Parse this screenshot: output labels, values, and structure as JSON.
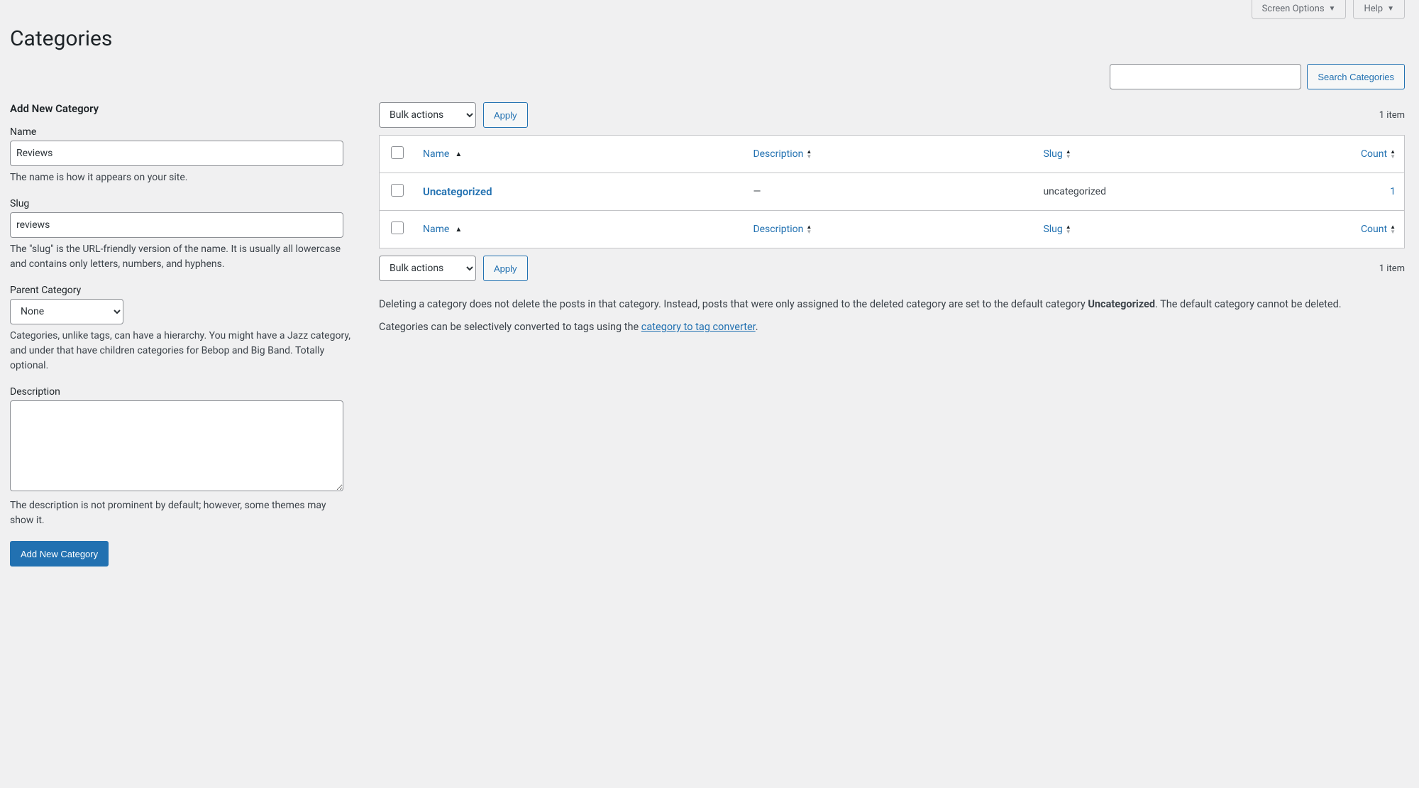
{
  "topTabs": {
    "screenOptions": "Screen Options",
    "help": "Help"
  },
  "pageTitle": "Categories",
  "search": {
    "value": "",
    "button": "Search Categories"
  },
  "form": {
    "heading": "Add New Category",
    "name": {
      "label": "Name",
      "value": "Reviews",
      "help": "The name is how it appears on your site."
    },
    "slug": {
      "label": "Slug",
      "value": "reviews",
      "help": "The \"slug\" is the URL-friendly version of the name. It is usually all lowercase and contains only letters, numbers, and hyphens."
    },
    "parent": {
      "label": "Parent Category",
      "value": "None",
      "help": "Categories, unlike tags, can have a hierarchy. You might have a Jazz category, and under that have children categories for Bebop and Big Band. Totally optional."
    },
    "description": {
      "label": "Description",
      "value": "",
      "help": "The description is not prominent by default; however, some themes may show it."
    },
    "submit": "Add New Category"
  },
  "bulk": {
    "label": "Bulk actions",
    "apply": "Apply"
  },
  "pagination": {
    "itemCount": "1 item"
  },
  "columns": {
    "name": "Name",
    "description": "Description",
    "slug": "Slug",
    "count": "Count"
  },
  "rows": [
    {
      "name": "Uncategorized",
      "description": "—",
      "slug": "uncategorized",
      "count": "1"
    }
  ],
  "notes": {
    "p1a": "Deleting a category does not delete the posts in that category. Instead, posts that were only assigned to the deleted category are set to the default category ",
    "p1bold": "Uncategorized",
    "p1b": ". The default category cannot be deleted.",
    "p2a": "Categories can be selectively converted to tags using the ",
    "p2link": "category to tag converter",
    "p2b": "."
  }
}
